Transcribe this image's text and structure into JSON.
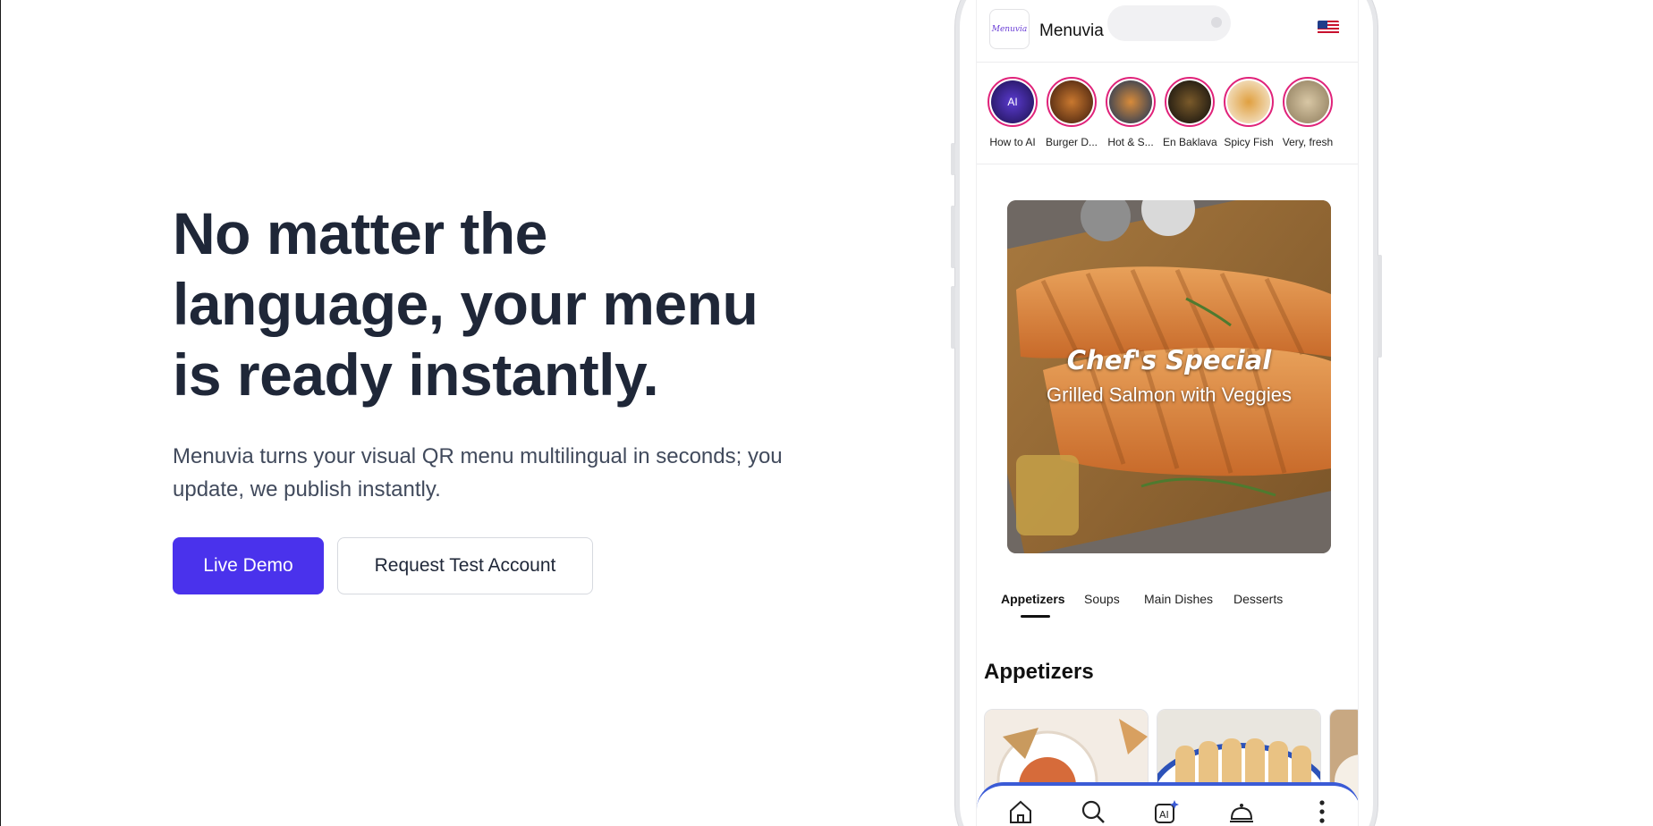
{
  "hero": {
    "headline_line1": "No matter the",
    "headline_line2": "language, your menu",
    "headline_line3": "is ready instantly.",
    "subtext": "Menuvia turns your visual QR menu multilingual in seconds; you update, we publish instantly.",
    "primary_button": "Live Demo",
    "secondary_button": "Request Test Account"
  },
  "phone": {
    "app_name": "Menuvia",
    "logo_text": "Menuvia",
    "language_icon": "us-flag-icon",
    "stories": [
      {
        "label": "How to AI",
        "badge": "AI",
        "color": "#3a1d8f"
      },
      {
        "label": "Burger D...",
        "badge": "",
        "color": "#7a2e1c"
      },
      {
        "label": "Hot & S...",
        "badge": "",
        "color": "#1b3e6e"
      },
      {
        "label": "En Baklava",
        "badge": "",
        "color": "#141414"
      },
      {
        "label": "Spicy Fish",
        "badge": "",
        "color": "#f2e9d8"
      },
      {
        "label": "Very, fresh",
        "badge": "",
        "color": "#c9b99c"
      }
    ],
    "featured": {
      "title": "Chef's Special",
      "subtitle": "Grilled Salmon with Veggies"
    },
    "tabs": [
      "Appetizers",
      "Soups",
      "Main Dishes",
      "Desserts"
    ],
    "active_tab": "Appetizers",
    "section_title": "Appetizers",
    "bottom_nav": [
      "home-icon",
      "search-icon",
      "ai-icon",
      "service-bell-icon",
      "more-icon"
    ]
  },
  "colors": {
    "primary": "#4a32ec",
    "heading": "#1f2738",
    "story_ring": "#e0237a",
    "nav_accent": "#3b5bd6"
  }
}
